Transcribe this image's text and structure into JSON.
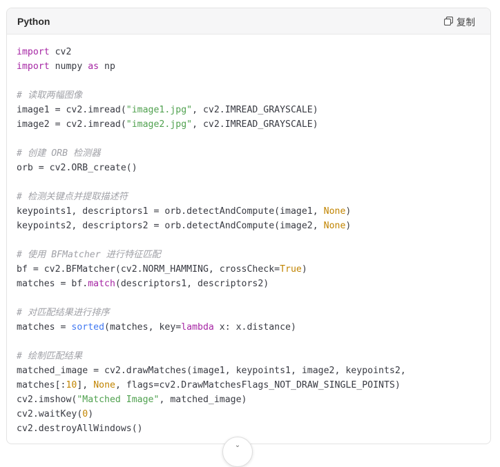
{
  "header": {
    "language": "Python",
    "copy_label": "复制"
  },
  "code": {
    "lines": [
      [
        {
          "t": "import",
          "c": "kw"
        },
        {
          "t": " cv2"
        }
      ],
      [
        {
          "t": "import",
          "c": "kw"
        },
        {
          "t": " numpy "
        },
        {
          "t": "as",
          "c": "kw"
        },
        {
          "t": " np"
        }
      ],
      [],
      [
        {
          "t": "# 读取两幅图像",
          "c": "cm"
        }
      ],
      [
        {
          "t": "image1 = cv2.imread("
        },
        {
          "t": "\"image1.jpg\"",
          "c": "str"
        },
        {
          "t": ", cv2.IMREAD_GRAYSCALE)"
        }
      ],
      [
        {
          "t": "image2 = cv2.imread("
        },
        {
          "t": "\"image2.jpg\"",
          "c": "str"
        },
        {
          "t": ", cv2.IMREAD_GRAYSCALE)"
        }
      ],
      [],
      [
        {
          "t": "# 创建 ORB 检测器",
          "c": "cm"
        }
      ],
      [
        {
          "t": "orb = cv2.ORB_create()"
        }
      ],
      [],
      [
        {
          "t": "# 检测关键点并提取描述符",
          "c": "cm"
        }
      ],
      [
        {
          "t": "keypoints1, descriptors1 = orb.detectAndCompute(image1, "
        },
        {
          "t": "None",
          "c": "num"
        },
        {
          "t": ")"
        }
      ],
      [
        {
          "t": "keypoints2, descriptors2 = orb.detectAndCompute(image2, "
        },
        {
          "t": "None",
          "c": "num"
        },
        {
          "t": ")"
        }
      ],
      [],
      [
        {
          "t": "# 使用 BFMatcher 进行特征匹配",
          "c": "cm"
        }
      ],
      [
        {
          "t": "bf = cv2.BFMatcher(cv2.NORM_HAMMING, crossCheck="
        },
        {
          "t": "True",
          "c": "num"
        },
        {
          "t": ")"
        }
      ],
      [
        {
          "t": "matches = bf."
        },
        {
          "t": "match",
          "c": "kw"
        },
        {
          "t": "(descriptors1, descriptors2)"
        }
      ],
      [],
      [
        {
          "t": "# 对匹配结果进行排序",
          "c": "cm"
        }
      ],
      [
        {
          "t": "matches = "
        },
        {
          "t": "sorted",
          "c": "bi"
        },
        {
          "t": "(matches, key="
        },
        {
          "t": "lambda",
          "c": "kw"
        },
        {
          "t": " x: x.distance)"
        }
      ],
      [],
      [
        {
          "t": "# 绘制匹配结果",
          "c": "cm"
        }
      ],
      [
        {
          "t": "matched_image = cv2.drawMatches(image1, keypoints1, image2, keypoints2,"
        }
      ],
      [
        {
          "t": "matches[:"
        },
        {
          "t": "10",
          "c": "num"
        },
        {
          "t": "], "
        },
        {
          "t": "None",
          "c": "num"
        },
        {
          "t": ", flags=cv2.DrawMatchesFlags_NOT_DRAW_SINGLE_POINTS)"
        }
      ],
      [
        {
          "t": "cv2.imshow("
        },
        {
          "t": "\"Matched Image\"",
          "c": "str"
        },
        {
          "t": ", matched_image)"
        }
      ],
      [
        {
          "t": "cv2.waitKey("
        },
        {
          "t": "0",
          "c": "num"
        },
        {
          "t": ")"
        }
      ],
      [
        {
          "t": "cv2.destroyAllWindows()"
        }
      ]
    ]
  },
  "icons": {
    "copy": "copy-icon",
    "expand": "chevron-down-icon"
  }
}
